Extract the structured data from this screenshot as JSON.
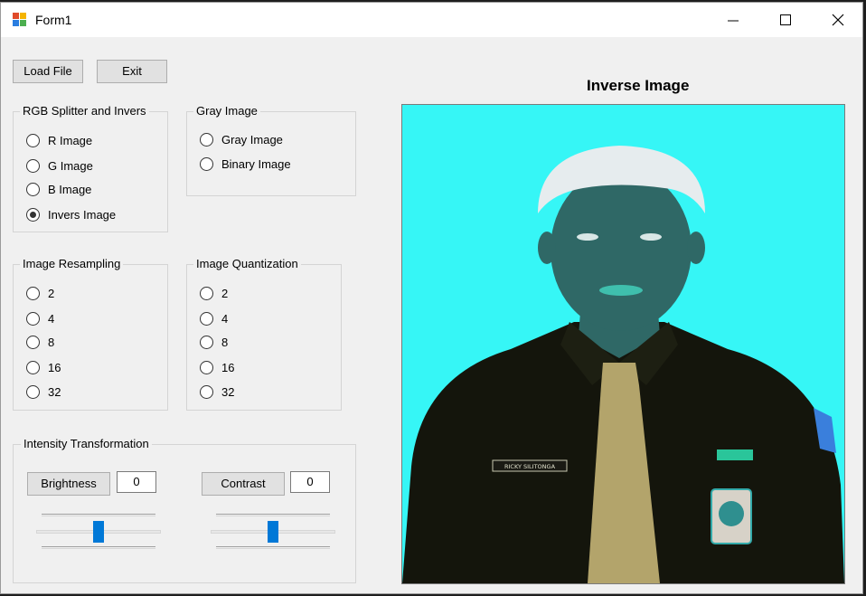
{
  "window": {
    "title": "Form1"
  },
  "toolbar": {
    "load_label": "Load File",
    "exit_label": "Exit"
  },
  "rgb_group": {
    "title": "RGB Splitter and Invers",
    "options": [
      {
        "label": "R Image",
        "checked": false
      },
      {
        "label": "G Image",
        "checked": false
      },
      {
        "label": "B Image",
        "checked": false
      },
      {
        "label": "Invers Image",
        "checked": true
      }
    ]
  },
  "gray_group": {
    "title": "Gray Image",
    "options": [
      {
        "label": "Gray Image",
        "checked": false
      },
      {
        "label": "Binary Image",
        "checked": false
      }
    ]
  },
  "resampling_group": {
    "title": "Image Resampling",
    "options": [
      {
        "label": "2"
      },
      {
        "label": "4"
      },
      {
        "label": "8"
      },
      {
        "label": "16"
      },
      {
        "label": "32"
      }
    ]
  },
  "quantization_group": {
    "title": "Image Quantization",
    "options": [
      {
        "label": "2"
      },
      {
        "label": "4"
      },
      {
        "label": "8"
      },
      {
        "label": "16"
      },
      {
        "label": "32"
      }
    ]
  },
  "intensity_group": {
    "title": "Intensity Transformation",
    "brightness_label": "Brightness",
    "brightness_value": "0",
    "brightness_level": 0.5,
    "contrast_label": "Contrast",
    "contrast_value": "0",
    "contrast_level": 0.5
  },
  "picture": {
    "title": "Inverse Image",
    "name_tag": "RICKY SILITONGA"
  },
  "colors": {
    "accent": "#0078d7",
    "picture_background": "#36f6f6",
    "shirt": "#14150c",
    "tie": "#b3a46b",
    "skin": "#2f6866",
    "hair": "#e6ecee"
  }
}
